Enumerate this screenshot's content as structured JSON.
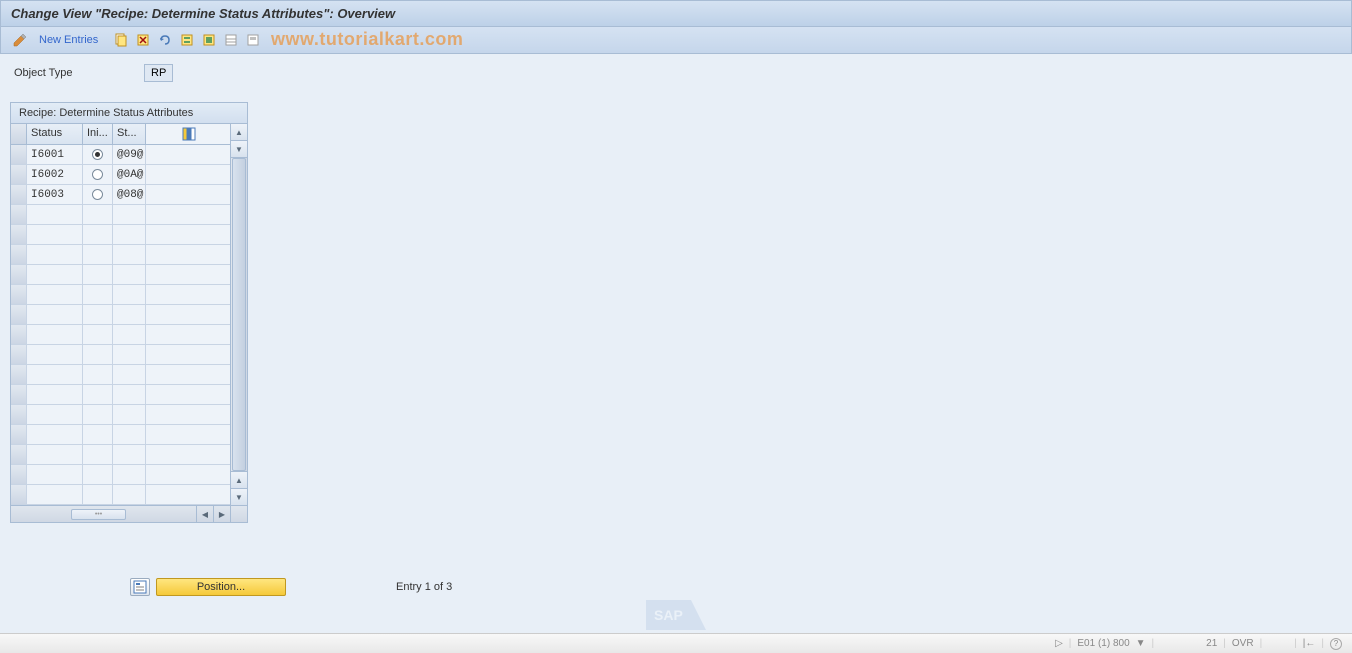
{
  "title": "Change View \"Recipe: Determine Status Attributes\": Overview",
  "toolbar": {
    "new_entries": "New Entries"
  },
  "watermark": "www.tutorialkart.com",
  "object_type": {
    "label": "Object Type",
    "value": "RP"
  },
  "table": {
    "title": "Recipe: Determine Status Attributes",
    "columns": {
      "status": "Status",
      "ini": "Ini...",
      "st": "St..."
    },
    "rows": [
      {
        "status": "I6001",
        "selected": true,
        "st": "@09@"
      },
      {
        "status": "I6002",
        "selected": false,
        "st": "@0A@"
      },
      {
        "status": "I6003",
        "selected": false,
        "st": "@08@"
      }
    ]
  },
  "bottom": {
    "position_label": "Position...",
    "entry_text": "Entry 1 of 3"
  },
  "statusbar": {
    "session": "E01 (1) 800",
    "client": "21",
    "mode": "OVR"
  }
}
